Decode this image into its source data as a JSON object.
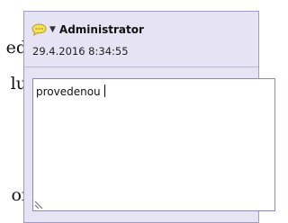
{
  "background_document": {
    "fragments": [
      "ed",
      "lu",
      "oí"
    ]
  },
  "comment": {
    "author": "Administrator",
    "timestamp": "29.4.2016 8:34:55",
    "text": "provedenou",
    "icons": {
      "comment": "speech-bubble-icon",
      "dropdown": "chevron-down-icon",
      "resize": "resize-grip-icon"
    },
    "colors": {
      "panel_bg": "#e6e4f4",
      "panel_border": "#a09cc6",
      "icon_fill": "#f3e25a"
    }
  }
}
